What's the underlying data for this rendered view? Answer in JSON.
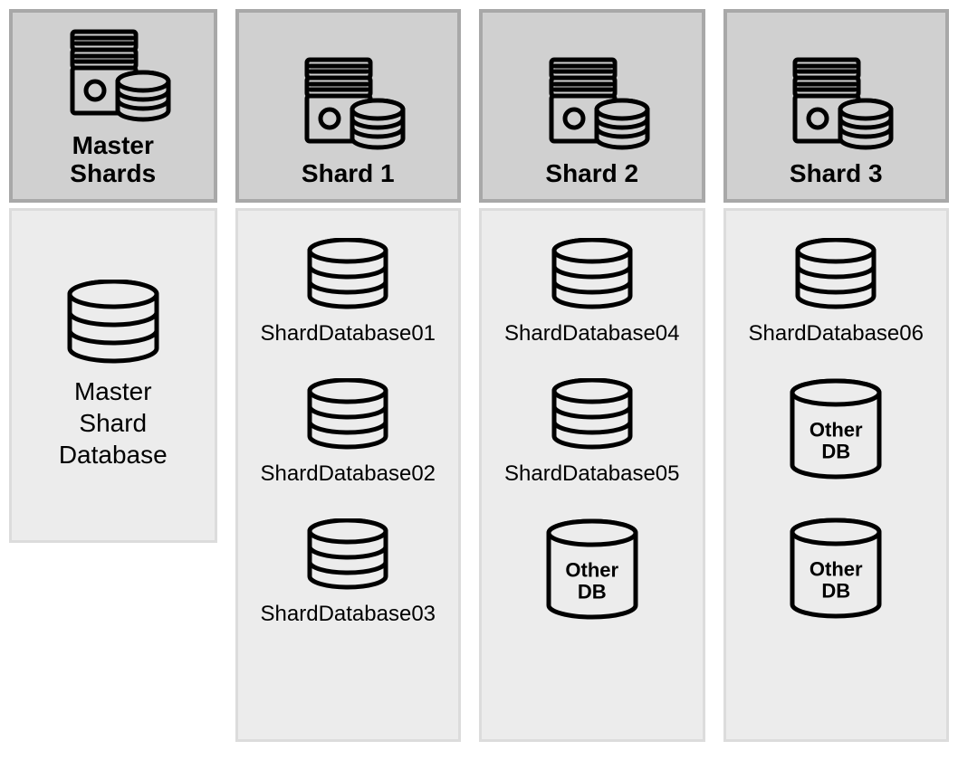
{
  "columns": {
    "master": {
      "title": "Master\nShards",
      "databases": [
        {
          "kind": "stack",
          "label": "Master\nShard\nDatabase"
        }
      ]
    },
    "shards": [
      {
        "title": "Shard 1",
        "databases": [
          {
            "kind": "stack",
            "label": "ShardDatabase01"
          },
          {
            "kind": "stack",
            "label": "ShardDatabase02"
          },
          {
            "kind": "stack",
            "label": "ShardDatabase03"
          }
        ]
      },
      {
        "title": "Shard 2",
        "databases": [
          {
            "kind": "stack",
            "label": "ShardDatabase04"
          },
          {
            "kind": "stack",
            "label": "ShardDatabase05"
          },
          {
            "kind": "other",
            "label": "Other\nDB"
          }
        ]
      },
      {
        "title": "Shard 3",
        "databases": [
          {
            "kind": "stack",
            "label": "ShardDatabase06"
          },
          {
            "kind": "other",
            "label": "Other\nDB"
          },
          {
            "kind": "other",
            "label": "Other\nDB"
          }
        ]
      }
    ]
  }
}
